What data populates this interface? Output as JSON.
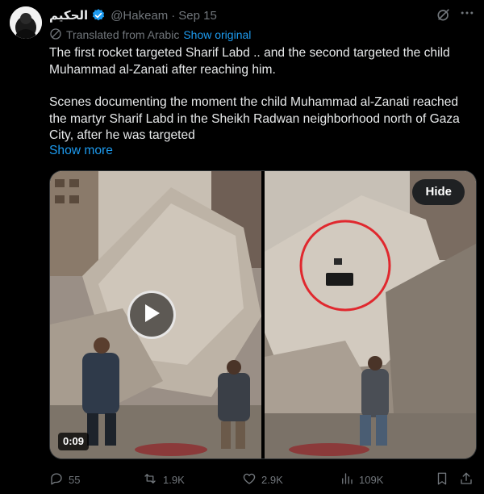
{
  "post": {
    "author_name": "الحكيم",
    "author_handle": "@Hakeam",
    "separator": "·",
    "date": "Sep 15",
    "translated_label": "Translated from Arabic",
    "show_original": "Show original",
    "paragraph_1": "The first rocket targeted Sharif Labd .. and the second targeted the child Muhammad al-Zanati after reaching him.",
    "paragraph_2": "Scenes documenting the moment the child Muhammad al-Zanati reached the martyr Sharif Labd in the Sheikh Radwan neighborhood north of Gaza City, after he was targeted",
    "show_more": "Show more"
  },
  "media": {
    "video_duration": "0:09",
    "hide_label": "Hide",
    "marker_color": "#e0282e"
  },
  "actions": {
    "replies": "55",
    "reposts": "1.9K",
    "likes": "2.9K",
    "views": "109K"
  },
  "colors": {
    "background": "#000000",
    "text": "#e7e9ea",
    "muted": "#71767b",
    "accent": "#1d9bf0"
  },
  "icons": [
    "verified-badge-icon",
    "grok-icon",
    "more-icon",
    "translate-icon",
    "play-icon",
    "reply-icon",
    "repost-icon",
    "like-icon",
    "views-icon",
    "bookmark-icon",
    "share-icon"
  ]
}
